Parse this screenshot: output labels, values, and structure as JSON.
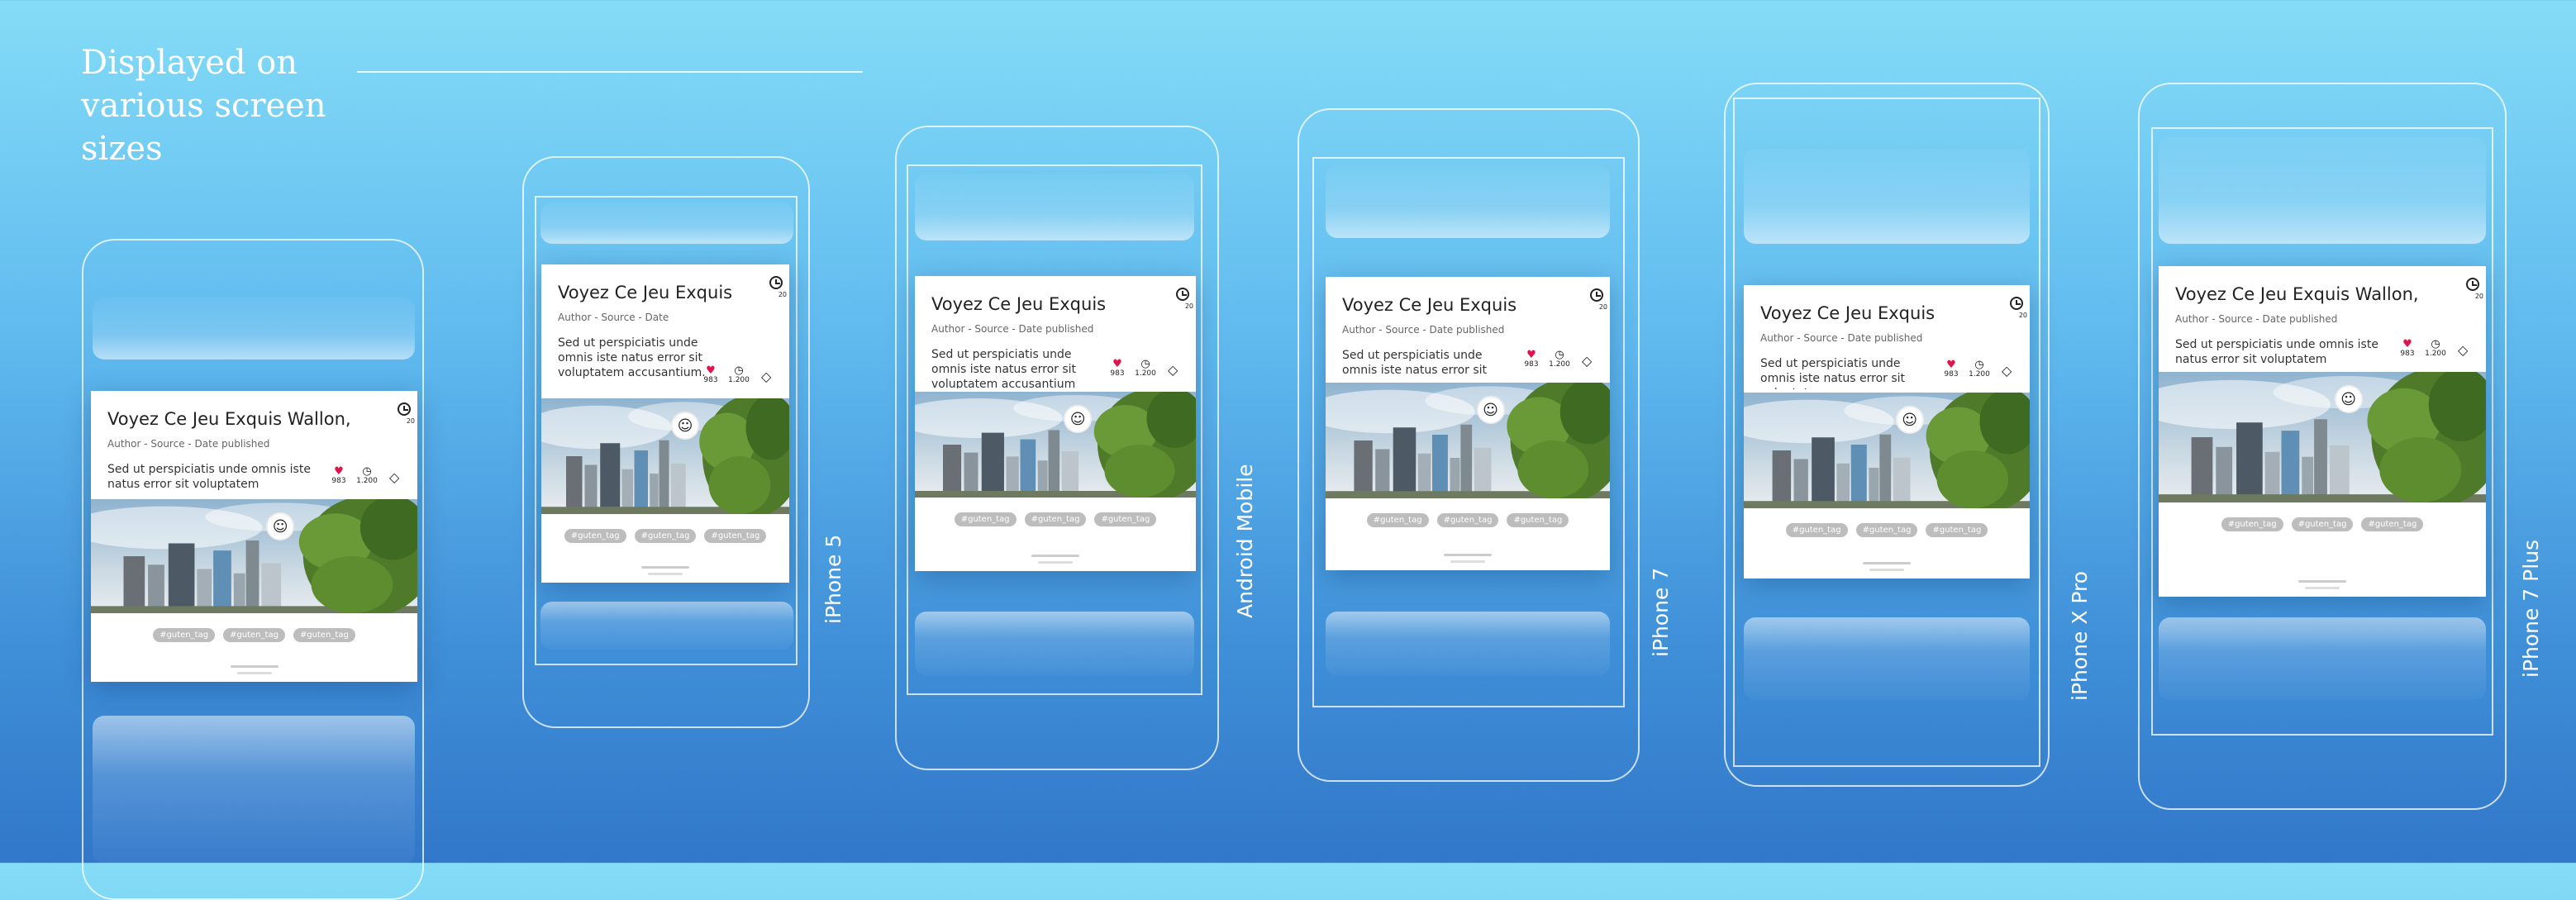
{
  "headline": "Displayed on various screen sizes",
  "card": {
    "author_line_full": "Author - Source - Date published",
    "author_line_short": "Author - Source - Date",
    "history_count": "20",
    "likes": "983",
    "reads": "1.200",
    "tags": [
      "#guten_tag",
      "#guten_tag",
      "#guten_tag"
    ]
  },
  "screens": [
    {
      "device": "",
      "title": "Voyez Ce Jeu Exquis Wallon,",
      "excerpt": "Sed ut perspiciatis unde omnis iste natus error sit voluptatem"
    },
    {
      "device": "iPhone 5",
      "title": "Voyez Ce Jeu Exquis",
      "excerpt": "Sed ut perspiciatis unde omnis iste natus error sit voluptatem accusantium."
    },
    {
      "device": "Android Mobile",
      "title": "Voyez Ce Jeu Exquis",
      "excerpt": "Sed ut perspiciatis unde omnis iste natus error sit voluptatem accusantium doloremque"
    },
    {
      "device": "iPhone 7",
      "title": "Voyez Ce Jeu Exquis",
      "excerpt": "Sed ut perspiciatis unde omnis iste natus error sit voluptatem"
    },
    {
      "device": "iPhone X Pro",
      "title": "Voyez Ce Jeu Exquis",
      "excerpt": "Sed ut perspiciatis unde omnis iste natus error sit voluptatem"
    },
    {
      "device": "iPhone 7 Plus",
      "title": "Voyez Ce Jeu Exquis Wallon,",
      "excerpt": "Sed ut perspiciatis unde omnis iste natus error sit voluptatem accusantium doloremque laudantium,"
    }
  ],
  "icons": {
    "history": "history-icon",
    "heart": "heart-icon",
    "clock": "clock-icon",
    "book": "book-icon",
    "avatar": "avatar-icon"
  }
}
